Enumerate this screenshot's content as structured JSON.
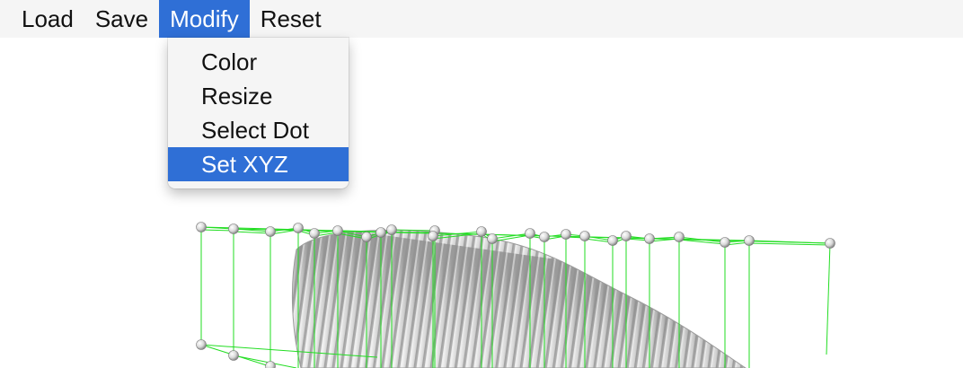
{
  "menubar": {
    "items": [
      {
        "label": "Load"
      },
      {
        "label": "Save"
      },
      {
        "label": "Modify"
      },
      {
        "label": "Reset"
      }
    ],
    "active_index": 2
  },
  "modify_menu": {
    "items": [
      {
        "label": "Color"
      },
      {
        "label": "Resize"
      },
      {
        "label": "Select Dot"
      },
      {
        "label": "Set XYZ"
      }
    ],
    "selected_index": 3
  },
  "viewport": {
    "wireframe_color": "#22dd22",
    "control_point_color": "#e6e6e6",
    "mesh_color": "#d9d9d9",
    "background": "#ffffff"
  },
  "colors": {
    "menubar_bg": "#f5f5f5",
    "highlight": "#2f6fd6"
  }
}
